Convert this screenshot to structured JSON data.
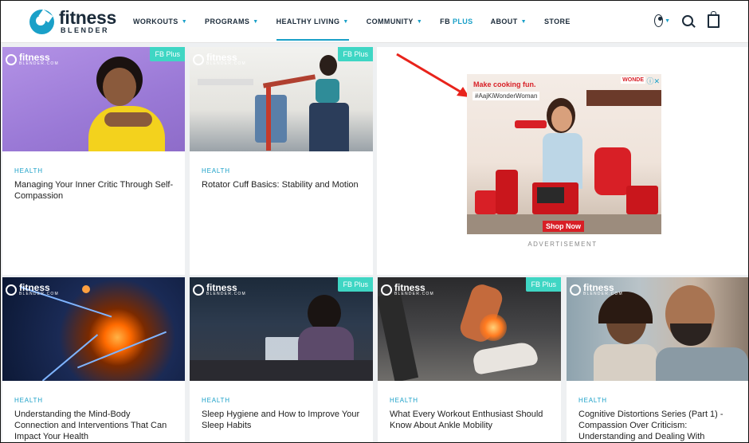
{
  "brand": {
    "name": "fitness",
    "sub": "BLENDER",
    "accent": "#1aa0c8",
    "badge_color": "#3fd6c4"
  },
  "nav": {
    "items": [
      {
        "label": "WORKOUTS",
        "caret": true
      },
      {
        "label": "PROGRAMS",
        "caret": true
      },
      {
        "label": "HEALTHY LIVING",
        "caret": true,
        "active": true
      },
      {
        "label": "COMMUNITY",
        "caret": true
      },
      {
        "label": "FB",
        "plus": "PLUS"
      },
      {
        "label": "ABOUT",
        "caret": true
      },
      {
        "label": "STORE"
      }
    ],
    "icons": [
      "user-icon",
      "search-icon",
      "bag-icon"
    ]
  },
  "watermark": {
    "word": "fitness",
    "sub": "BLENDER.COM"
  },
  "cards": [
    {
      "badge": "FB Plus",
      "category": "HEALTH",
      "title": "Managing Your Inner Critic Through Self-Compassion"
    },
    {
      "badge": "FB Plus",
      "category": "HEALTH",
      "title": "Rotator Cuff Basics: Stability and Motion"
    },
    {
      "badge": "",
      "category": "HEALTH",
      "title": "Understanding the Mind-Body Connection and Interventions That Can Impact Your Health"
    },
    {
      "badge": "FB Plus",
      "category": "HEALTH",
      "title": "Sleep Hygiene and How to Improve Your Sleep Habits"
    },
    {
      "badge": "FB Plus",
      "category": "HEALTH",
      "title": "What Every Workout Enthusiast Should Know About Ankle Mobility"
    },
    {
      "badge": "",
      "category": "HEALTH",
      "title": "Cognitive Distortions Series (Part 1) - Compassion Over Criticism: Understanding and Dealing With"
    }
  ],
  "ad": {
    "headline": "Make cooking fun.",
    "hashtag": "#AajKiWonderWoman",
    "brand": "WONDE",
    "cta": "Shop Now",
    "label": "ADVERTISEMENT"
  }
}
